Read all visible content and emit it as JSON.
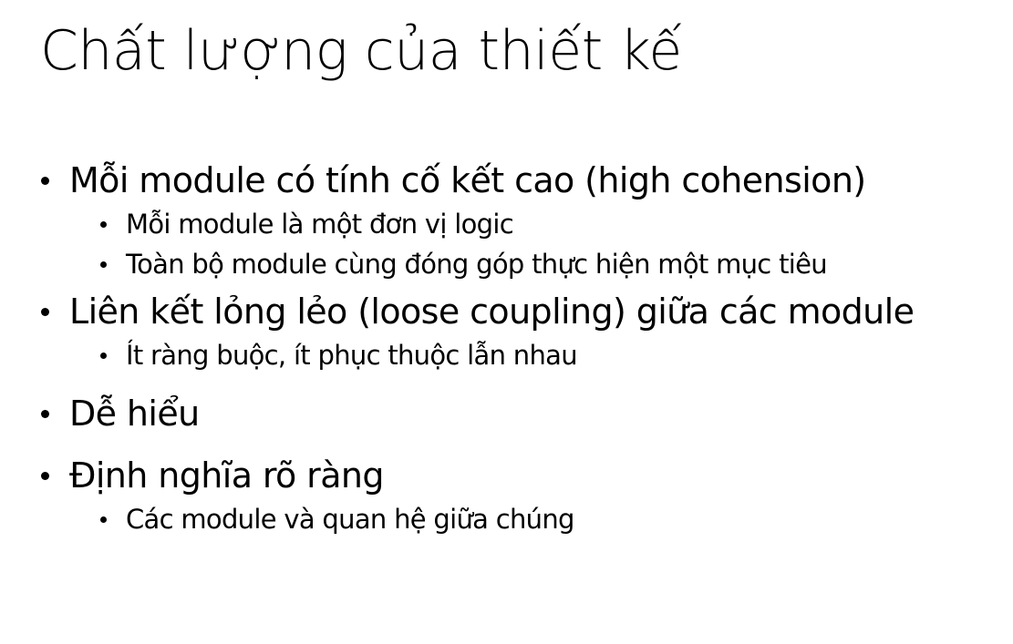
{
  "slide": {
    "title": "Chất lượng của thiết kế",
    "bullets": [
      {
        "text": "Mỗi module có tính cố kết cao (high cohension)",
        "sub": [
          "Mỗi module là một đơn vị logic",
          "Toàn bộ module cùng đóng góp thực hiện một mục tiêu"
        ]
      },
      {
        "text": "Liên kết lỏng lẻo (loose coupling) giữa các module",
        "sub": [
          "Ít ràng buộc, ít phục thuộc lẫn nhau"
        ]
      },
      {
        "text": "Dễ hiểu",
        "sub": []
      },
      {
        "text": "Định nghĩa rõ ràng",
        "sub": [
          "Các module và quan hệ giữa chúng"
        ]
      }
    ]
  },
  "colors": {
    "background": "#ffffff",
    "text": "#000000"
  }
}
